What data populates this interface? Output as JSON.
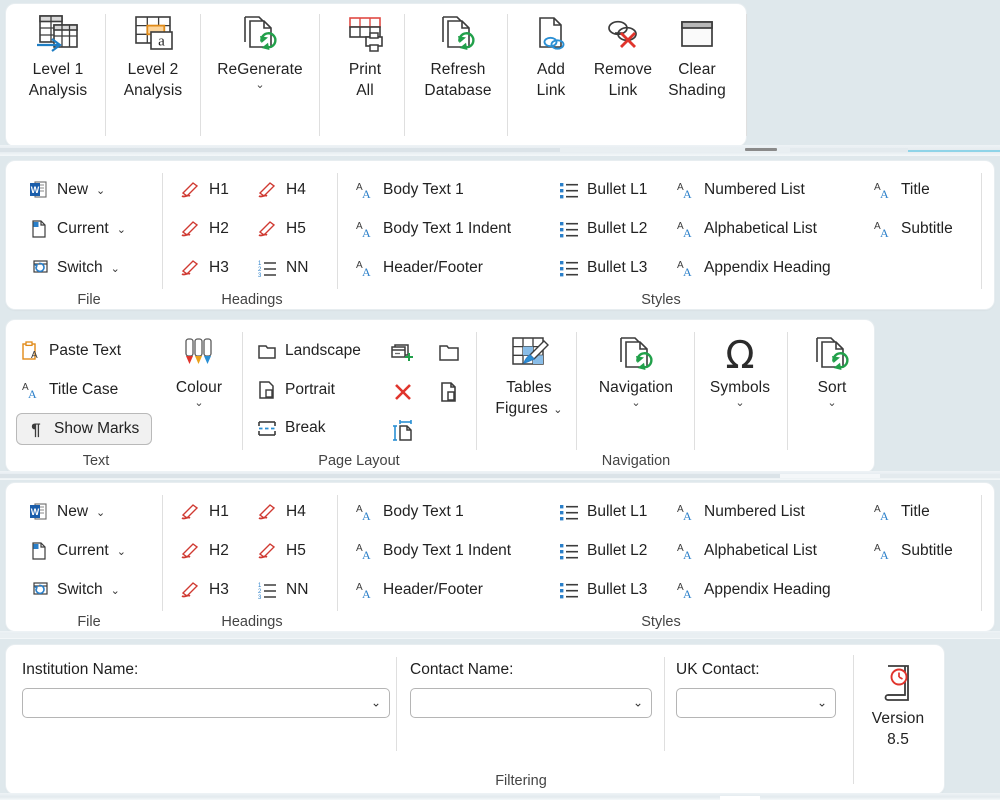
{
  "app": {
    "background_color": "#dfe8ec",
    "panel_color": "#ffffff"
  },
  "ribbon_analysis": {
    "buttons": [
      {
        "label_line1": "Level 1",
        "label_line2": "Analysis",
        "icon": "table-import-icon",
        "caret": false
      },
      {
        "label_line1": "Level 2",
        "label_line2": "Analysis",
        "icon": "table-annotate-icon",
        "caret": false
      },
      {
        "label_line1": "ReGenerate",
        "label_line2": "",
        "icon": "document-refresh-icon",
        "caret": true
      },
      {
        "label_line1": "Print",
        "label_line2": "All",
        "icon": "table-print-icon",
        "caret": false
      },
      {
        "label_line1": "Refresh",
        "label_line2": "Database",
        "icon": "document-refresh-icon",
        "caret": false
      },
      {
        "label_line1": "Add",
        "label_line2": "Link",
        "icon": "document-link-icon",
        "caret": false
      },
      {
        "label_line1": "Remove",
        "label_line2": "Link",
        "icon": "remove-link-icon",
        "caret": false
      },
      {
        "label_line1": "Clear",
        "label_line2": "Shading",
        "icon": "clear-shading-icon",
        "caret": false
      }
    ]
  },
  "ribbon_styles": {
    "groups": [
      {
        "name": "File",
        "label": "File",
        "items": [
          {
            "label": "New",
            "icon": "word-new-document-icon",
            "caret": true
          },
          {
            "label": "Current",
            "icon": "current-document-icon",
            "caret": true
          },
          {
            "label": "Switch",
            "icon": "switch-window-icon",
            "caret": true
          }
        ]
      },
      {
        "name": "Headings",
        "label": "Headings",
        "items": [
          {
            "label": "H1",
            "icon": "pen-heading-icon",
            "caret": false
          },
          {
            "label": "H2",
            "icon": "pen-heading-icon",
            "caret": false
          },
          {
            "label": "H3",
            "icon": "pen-heading-icon",
            "caret": false
          },
          {
            "label": "H4",
            "icon": "pen-heading-icon",
            "caret": false
          },
          {
            "label": "H5",
            "icon": "pen-heading-icon",
            "caret": false
          },
          {
            "label": "NN",
            "icon": "numbered-list-icon",
            "caret": false
          }
        ]
      },
      {
        "name": "Styles",
        "label": "Styles",
        "items": [
          {
            "label": "Body Text 1",
            "icon": "style-aa-icon",
            "caret": false
          },
          {
            "label": "Body Text 1 Indent",
            "icon": "style-aa-icon",
            "caret": false
          },
          {
            "label": "Header/Footer",
            "icon": "style-aa-icon",
            "caret": false
          },
          {
            "label": "Bullet L1",
            "icon": "bullet-list-icon",
            "caret": false
          },
          {
            "label": "Bullet L2",
            "icon": "bullet-list-icon",
            "caret": false
          },
          {
            "label": "Bullet L3",
            "icon": "bullet-list-icon",
            "caret": false
          },
          {
            "label": "Numbered List",
            "icon": "style-aa-icon",
            "caret": false
          },
          {
            "label": "Alphabetical List",
            "icon": "style-aa-icon",
            "caret": false
          },
          {
            "label": "Appendix Heading",
            "icon": "style-aa-icon",
            "caret": false
          },
          {
            "label": "Title",
            "icon": "style-aa-icon",
            "caret": false
          },
          {
            "label": "Subtitle",
            "icon": "style-aa-icon",
            "caret": false
          }
        ]
      }
    ]
  },
  "ribbon_text": {
    "groups": {
      "text": {
        "label": "Text",
        "items": [
          {
            "label": "Paste Text",
            "icon": "paste-text-icon",
            "toggled": false
          },
          {
            "label": "Title Case",
            "icon": "title-case-icon",
            "toggled": false
          },
          {
            "label": "Show Marks",
            "icon": "pilcrow-icon",
            "toggled": true
          }
        ],
        "colour_button": {
          "label": "Colour",
          "icon": "colour-pens-icon",
          "caret": true
        }
      },
      "page_layout": {
        "label": "Page Layout",
        "items": [
          {
            "label": "Landscape",
            "icon": "landscape-page-icon"
          },
          {
            "label": "Portrait",
            "icon": "portrait-page-icon"
          },
          {
            "label": "Break",
            "icon": "page-break-icon"
          }
        ],
        "icon_buttons": [
          {
            "icon": "add-window-icon"
          },
          {
            "icon": "new-folder-icon"
          },
          {
            "icon": "delete-cross-icon"
          },
          {
            "icon": "copy-page-icon"
          },
          {
            "icon": "resize-page-icon"
          }
        ]
      },
      "navigation": {
        "label": "Navigation",
        "buttons": [
          {
            "label_line1": "Tables",
            "label_line2": "Figures",
            "icon": "tables-figures-icon",
            "caret": true
          },
          {
            "label_line1": "Navigation",
            "label_line2": "",
            "icon": "document-refresh-icon",
            "caret": true
          }
        ]
      },
      "symbols": {
        "button": {
          "label_line1": "Symbols",
          "label_line2": "",
          "icon": "omega-icon",
          "caret": true
        }
      },
      "sort": {
        "button": {
          "label_line1": "Sort",
          "label_line2": "",
          "icon": "document-refresh-icon",
          "caret": true
        }
      }
    }
  },
  "filtering": {
    "label": "Filtering",
    "fields": [
      {
        "label": "Institution Name:",
        "value": "",
        "options": [
          ""
        ]
      },
      {
        "label": "Contact Name:",
        "value": "",
        "options": [
          ""
        ]
      },
      {
        "label": "UK Contact:",
        "value": "",
        "options": [
          ""
        ]
      }
    ],
    "version_button": {
      "label_line1": "Version",
      "label_line2": "8.5",
      "icon": "version-history-book-icon"
    }
  }
}
